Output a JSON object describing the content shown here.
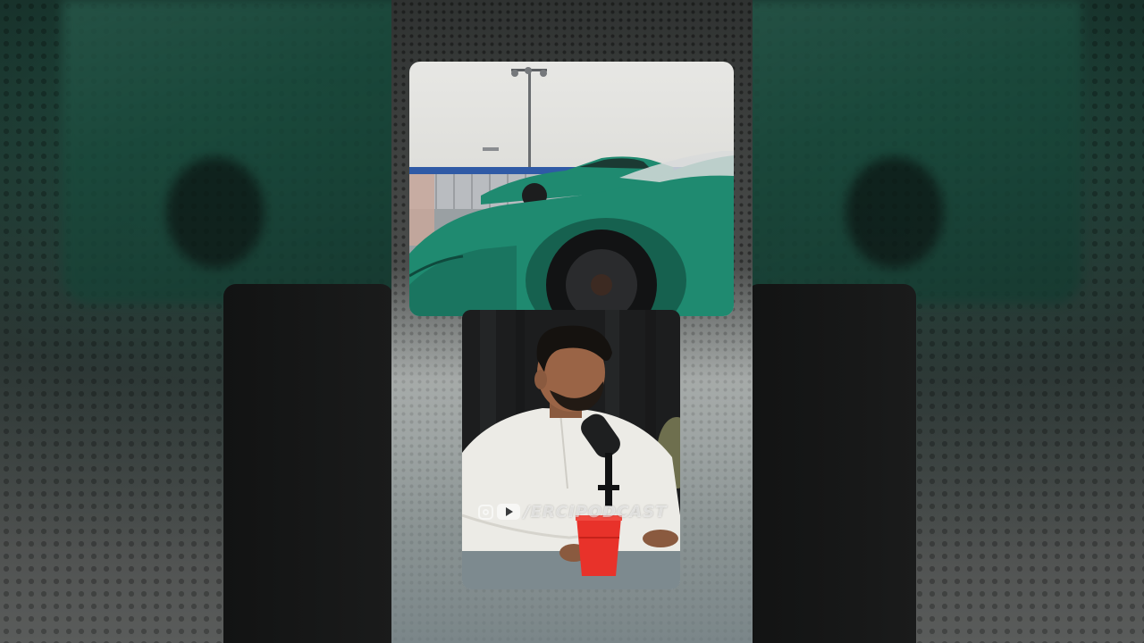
{
  "video": {
    "watermark": {
      "text": "/ERCIPODCAST",
      "icons": [
        "instagram-icon",
        "youtube-icon"
      ]
    },
    "scenes": [
      {
        "name": "car-clip",
        "car_color": "#1f8a70"
      },
      {
        "name": "podcast-clip",
        "cup_color": "#e8322a",
        "shirt_color": "#ecebe6"
      }
    ]
  }
}
